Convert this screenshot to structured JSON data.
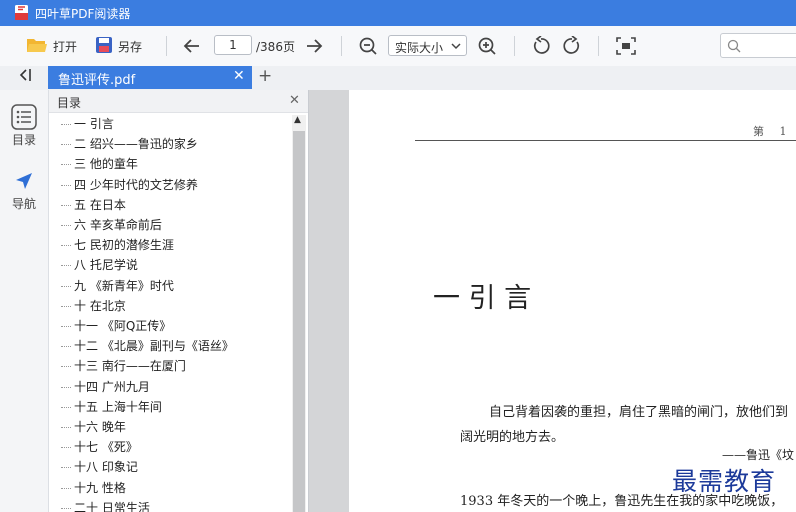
{
  "app": {
    "title": "四叶草PDF阅读器"
  },
  "toolbar": {
    "open_label": "打开",
    "saveas_label": "另存",
    "current_page": "1",
    "total_pages": "/386页",
    "zoom_value": "实际大小"
  },
  "tabs": [
    {
      "label": "鲁迅评传.pdf"
    }
  ],
  "rail": {
    "toc_label": "目录",
    "nav_label": "导航"
  },
  "toc": {
    "title": "目录",
    "items": [
      "一  引言",
      "二  绍兴——鲁迅的家乡",
      "三  他的童年",
      "四  少年时代的文艺修养",
      "五  在日本",
      "六  辛亥革命前后",
      "七  民初的潜修生涯",
      "八  托尼学说",
      "九 《新青年》时代",
      "十  在北京",
      "十一 《阿Q正传》",
      "十二 《北晨》副刊与《语丝》",
      "十三  南行——在厦门",
      "十四  广州九月",
      "十五  上海十年间",
      "十六  晚年",
      "十七 《死》",
      "十八  印象记",
      "十九  性格",
      "二十  日常生活"
    ]
  },
  "document": {
    "page_header": "第 1",
    "chapter_title": "一  引    言",
    "line1": "自己背着因袭的重担，肩住了黑暗的闸门，放他们到",
    "line2": "阔光明的地方去。",
    "attribution": "——鲁迅《坟",
    "line3": "1933 年冬天的一个晚上，鲁迅先生在我的家中吃晚饭，"
  },
  "watermark": "最需教育",
  "colors": {
    "accent": "#3b7de0",
    "tab_bg": "#3b7de0",
    "watermark": "#1c3a9a"
  }
}
